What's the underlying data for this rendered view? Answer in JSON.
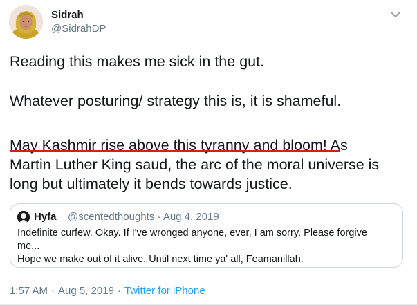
{
  "author": {
    "name": "Sidrah",
    "handle": "@SidrahDP"
  },
  "tweet": {
    "paragraph_1": "Reading this makes me sick in the gut.",
    "paragraph_2": "Whatever posturing/ strategy this is, it is shameful.",
    "paragraph_3_highlight": "May Kashmir rise above this tyranny and bloom!",
    "paragraph_3_after": " As",
    "paragraph_3_line_2": "Martin Luther King saud, the arc of the moral universe is",
    "paragraph_3_line_3": "long but ultimately it bends towards justice.",
    "highlight_color": "#d81b1b"
  },
  "quoted_tweet": {
    "name": "Hyfa",
    "handle": "@scentedthoughts",
    "date": "Aug 4, 2019",
    "lines": [
      "Indefinite curfew. Okay. If I've wronged anyone, ever, I am sorry. Please forgive",
      "me...",
      "Hope we make out of it alive. Until next time ya' all, Feamanillah."
    ]
  },
  "footer": {
    "time": "1:57 AM",
    "date": "Aug 5, 2019",
    "source": "Twitter for iPhone",
    "separator": "·"
  },
  "colors": {
    "text": "#14171a",
    "muted": "#657786",
    "link": "#1da1f2",
    "border": "#ccd6dd"
  },
  "icons": {
    "menu": "chevron-down-icon"
  }
}
